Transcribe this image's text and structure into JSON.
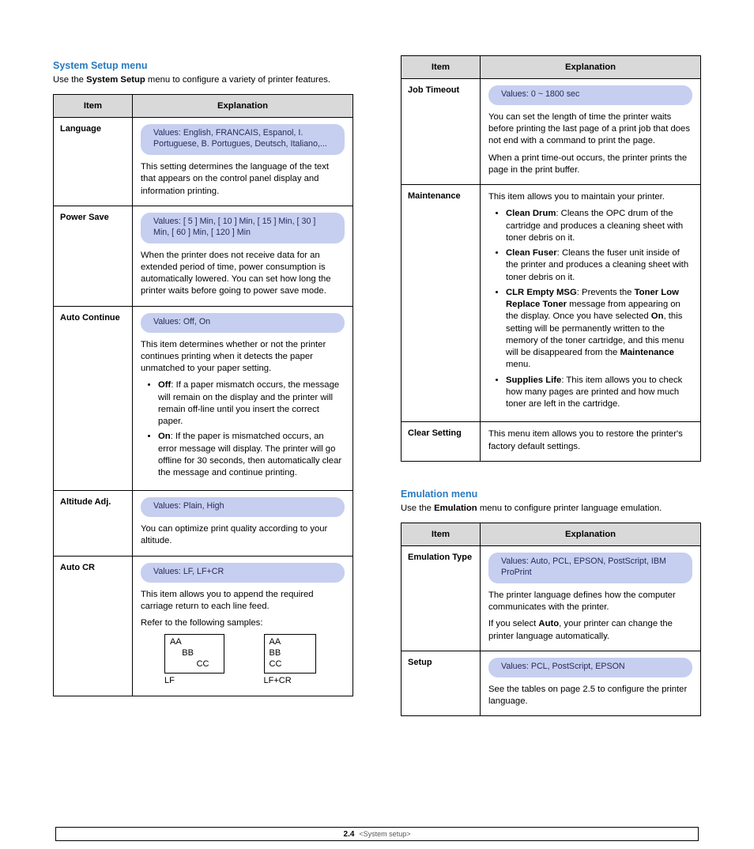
{
  "left": {
    "section_title": "System Setup menu",
    "intro_pre": "Use the ",
    "intro_menu": "System Setup",
    "intro_post": " menu to configure a variety of printer features.",
    "tbl": {
      "h1": "Item",
      "h2": "Explanation",
      "rows": [
        {
          "item": "Language",
          "vals": "Values: English, FRANCAIS, Espanol, I. Portuguese, B. Portugues, Deutsch, Italiano,...",
          "p1": "This setting determines the language of the text that appears on the control panel display and information printing."
        },
        {
          "item": "Power Save",
          "vals": "Values: [  5  ]  Min, [  10  ] Min, [  15  ] Min, [  30  ]  Min, [  60  ]  Min, [  120  ]  Min",
          "p1": "When the printer does not receive data for an extended period of time, power consumption is automatically lowered. You can set how long the printer waits before going to power save mode."
        },
        {
          "item": "Auto Continue",
          "vals": "Values: Off, On",
          "p1": "This item determines whether or not the printer continues printing when it detects the paper unmatched to your paper setting.",
          "li1_name": "Off",
          "li1_text": ": If a paper mismatch occurs, the message will remain on the display and the printer will remain off-line until you insert the correct paper.",
          "li2_name": "On",
          "li2_text": ": If the paper is mismatched occurs, an error message will display. The printer will go offline for 30 seconds, then automatically clear the message and continue printing."
        },
        {
          "item": "Altitude Adj.",
          "vals": "Values: Plain, High",
          "p1": "You can optimize print quality according to your altitude."
        },
        {
          "item": "Auto CR",
          "vals": "Values: LF, LF+CR",
          "p1": "This item allows you to append the required carriage return to each line feed.",
          "p2": "Refer to the following samples:",
          "sample1_l1": "AA",
          "sample1_l2": "     BB",
          "sample1_l3": "           CC",
          "sample1_lbl": "LF",
          "sample2_l1": "AA",
          "sample2_l2": "BB",
          "sample2_l3": "CC",
          "sample2_lbl": "LF+CR"
        }
      ]
    }
  },
  "right_top": {
    "tbl": {
      "h1": "Item",
      "h2": "Explanation",
      "rows": [
        {
          "item": "Job Timeout",
          "vals": "Values: 0 ~ 1800 sec",
          "p1": "You can set the length of time the printer waits before printing the last page of a print job that does not end with a command to print the page.",
          "p2": "When a print time-out occurs, the printer prints the page in the print buffer."
        },
        {
          "item": "Maintenance",
          "p1": "This item allows you to maintain your printer.",
          "li1_name": "Clean Drum",
          "li1_text": ": Cleans the OPC drum of the cartridge and produces a cleaning sheet with toner debris on it.",
          "li2_name": "Clean Fuser",
          "li2_text": ": Cleans the fuser unit inside of the printer and produces a cleaning sheet with toner debris on it.",
          "li3_name": "CLR Empty MSG",
          "li3_text_a": ": Prevents the ",
          "li3_bold": "Toner Low Replace Toner",
          "li3_text_b": " message from appearing on the display. Once you have selected ",
          "li3_bold2": "On",
          "li3_text_c": ", this setting will be permanently written to the memory of the toner cartridge, and this menu will be disappeared from the ",
          "li3_bold3": "Maintenance",
          "li3_text_d": " menu.",
          "li4_name": "Supplies Life",
          "li4_text": ": This item allows you to check how many pages are printed and how much toner are left in the cartridge."
        },
        {
          "item": "Clear Setting",
          "p1": "This menu item allows you to restore the printer's factory default settings."
        }
      ]
    }
  },
  "right_bottom": {
    "section_title": "Emulation menu",
    "intro_pre": "Use the ",
    "intro_menu": "Emulation",
    "intro_post": " menu to configure printer language emulation.",
    "tbl": {
      "h1": "Item",
      "h2": "Explanation",
      "rows": [
        {
          "item": "Emulation Type",
          "vals": "Values: Auto, PCL, EPSON, PostScript, IBM ProPrint",
          "p1": "The printer language defines how the computer communicates with the printer.",
          "p2_a": "If you select ",
          "p2_bold": "Auto",
          "p2_b": ", your printer can change the printer language automatically."
        },
        {
          "item": "Setup",
          "vals": "Values: PCL, PostScript, EPSON",
          "p1": "See the tables on page 2.5 to configure the printer language."
        }
      ]
    }
  },
  "footer": {
    "page_prefix": "2",
    "page_no": ".4",
    "section": "<System setup>"
  }
}
